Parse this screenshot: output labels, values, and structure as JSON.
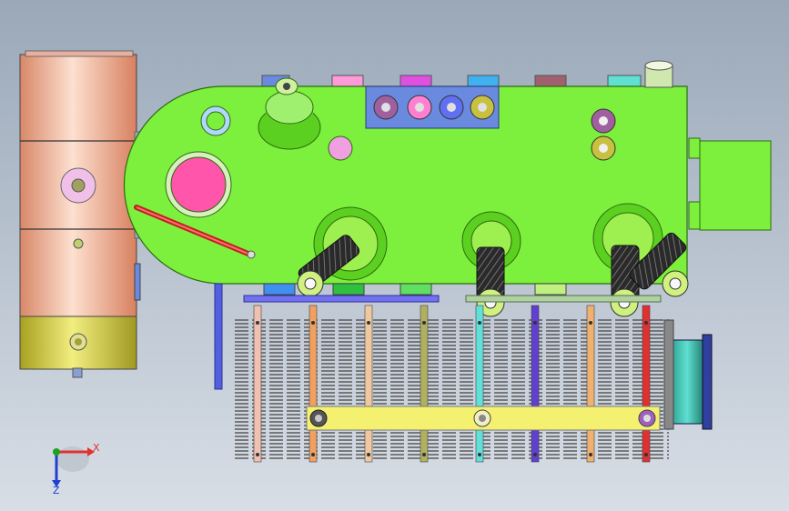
{
  "viewport": {
    "background_top": "#9aa8b8",
    "background_bottom": "#d8dee6"
  },
  "triad": {
    "x_label": "X",
    "z_label": "Z",
    "x_color": "#e53030",
    "z_color": "#2040d0",
    "y_color": "#20a020"
  },
  "colors": {
    "body_green": "#7cf03c",
    "tank_copper": "#f0b8a0",
    "tank_yellow": "#d8d040",
    "manway_pink": "#ff55aa",
    "flange_blue": "#6a8ae0",
    "grid_bar": "#5a5a5a",
    "header_yellow": "#f4f070"
  },
  "model": {
    "icons": [
      "tank-vessel-icon",
      "boiler-body-icon",
      "burner-icon",
      "tube-bank-icon",
      "header-pipe-icon"
    ]
  }
}
